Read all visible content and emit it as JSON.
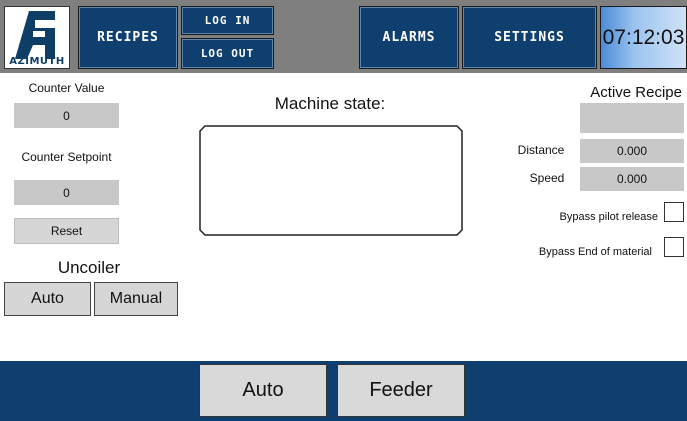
{
  "header": {
    "logo_text": "AZIMUTH",
    "recipes_label": "RECIPES",
    "login_label": "LOG IN",
    "logout_label": "LOG OUT",
    "alarms_label": "ALARMS",
    "settings_label": "SETTINGS",
    "clock": "07:12:03"
  },
  "counters": {
    "value_label": "Counter Value",
    "value": "0",
    "setpoint_label": "Counter Setpoint",
    "setpoint": "0",
    "reset_label": "Reset"
  },
  "uncoiler": {
    "label": "Uncoiler",
    "auto_label": "Auto",
    "manual_label": "Manual"
  },
  "machine": {
    "state_label": "Machine state:",
    "state_value": ""
  },
  "recipe": {
    "active_label": "Active Recipe",
    "active_value": "",
    "distance_label": "Distance",
    "distance_value": "0.000",
    "speed_label": "Speed",
    "speed_value": "0.000",
    "bypass_pilot_label": "Bypass pilot release",
    "bypass_pilot_checked": false,
    "bypass_end_label": "Bypass End of material",
    "bypass_end_checked": false
  },
  "footer": {
    "auto_label": "Auto",
    "feeder_label": "Feeder"
  },
  "colors": {
    "navy": "#0f3f6e",
    "header_gray": "#7f7f7f",
    "field_gray": "#c8c8c8"
  }
}
